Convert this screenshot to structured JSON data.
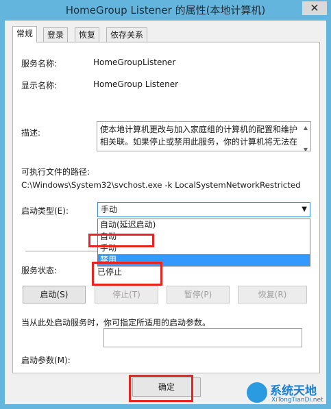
{
  "window": {
    "title": "HomeGroup Listener 的属性(本地计算机)",
    "close_glyph": "✕"
  },
  "tabs": [
    {
      "label": "常规",
      "active": true
    },
    {
      "label": "登录"
    },
    {
      "label": "恢复"
    },
    {
      "label": "依存关系"
    }
  ],
  "general": {
    "service_name_label": "服务名称:",
    "service_name": "HomeGroupListener",
    "display_name_label": "显示名称:",
    "display_name": "HomeGroup Listener",
    "description_label": "描述:",
    "description_line1": "使本地计算机更改与加入家庭组的计算机的配置和维护",
    "description_line2": "相关联。如果停止或禁用此服务，你的计算机将无法在",
    "path_label": "可执行文件的路径:",
    "path": "C:\\Windows\\System32\\svchost.exe -k LocalSystemNetworkRestricted",
    "startup_type_label": "启动类型(E):",
    "startup_type_value": "手动",
    "startup_options": [
      "自动(延迟启动)",
      "自动",
      "手动",
      "禁用"
    ],
    "service_status_label": "服务状态:",
    "service_status": "已停止",
    "buttons": {
      "start": "启动(S)",
      "stop": "停止(T)",
      "pause": "暂停(P)",
      "resume": "恢复(R)"
    },
    "hint": "当从此处启动服务时，你可指定所适用的启动参数。",
    "start_params_label": "启动参数(M):",
    "start_params_value": ""
  },
  "footer": {
    "ok": "确定"
  },
  "watermark": {
    "name": "系统天地",
    "url": "XiTongTianDi.net"
  },
  "colors": {
    "titlebar": "#63b5dd",
    "highlight": "#e8241e",
    "selection": "#3399ff"
  }
}
